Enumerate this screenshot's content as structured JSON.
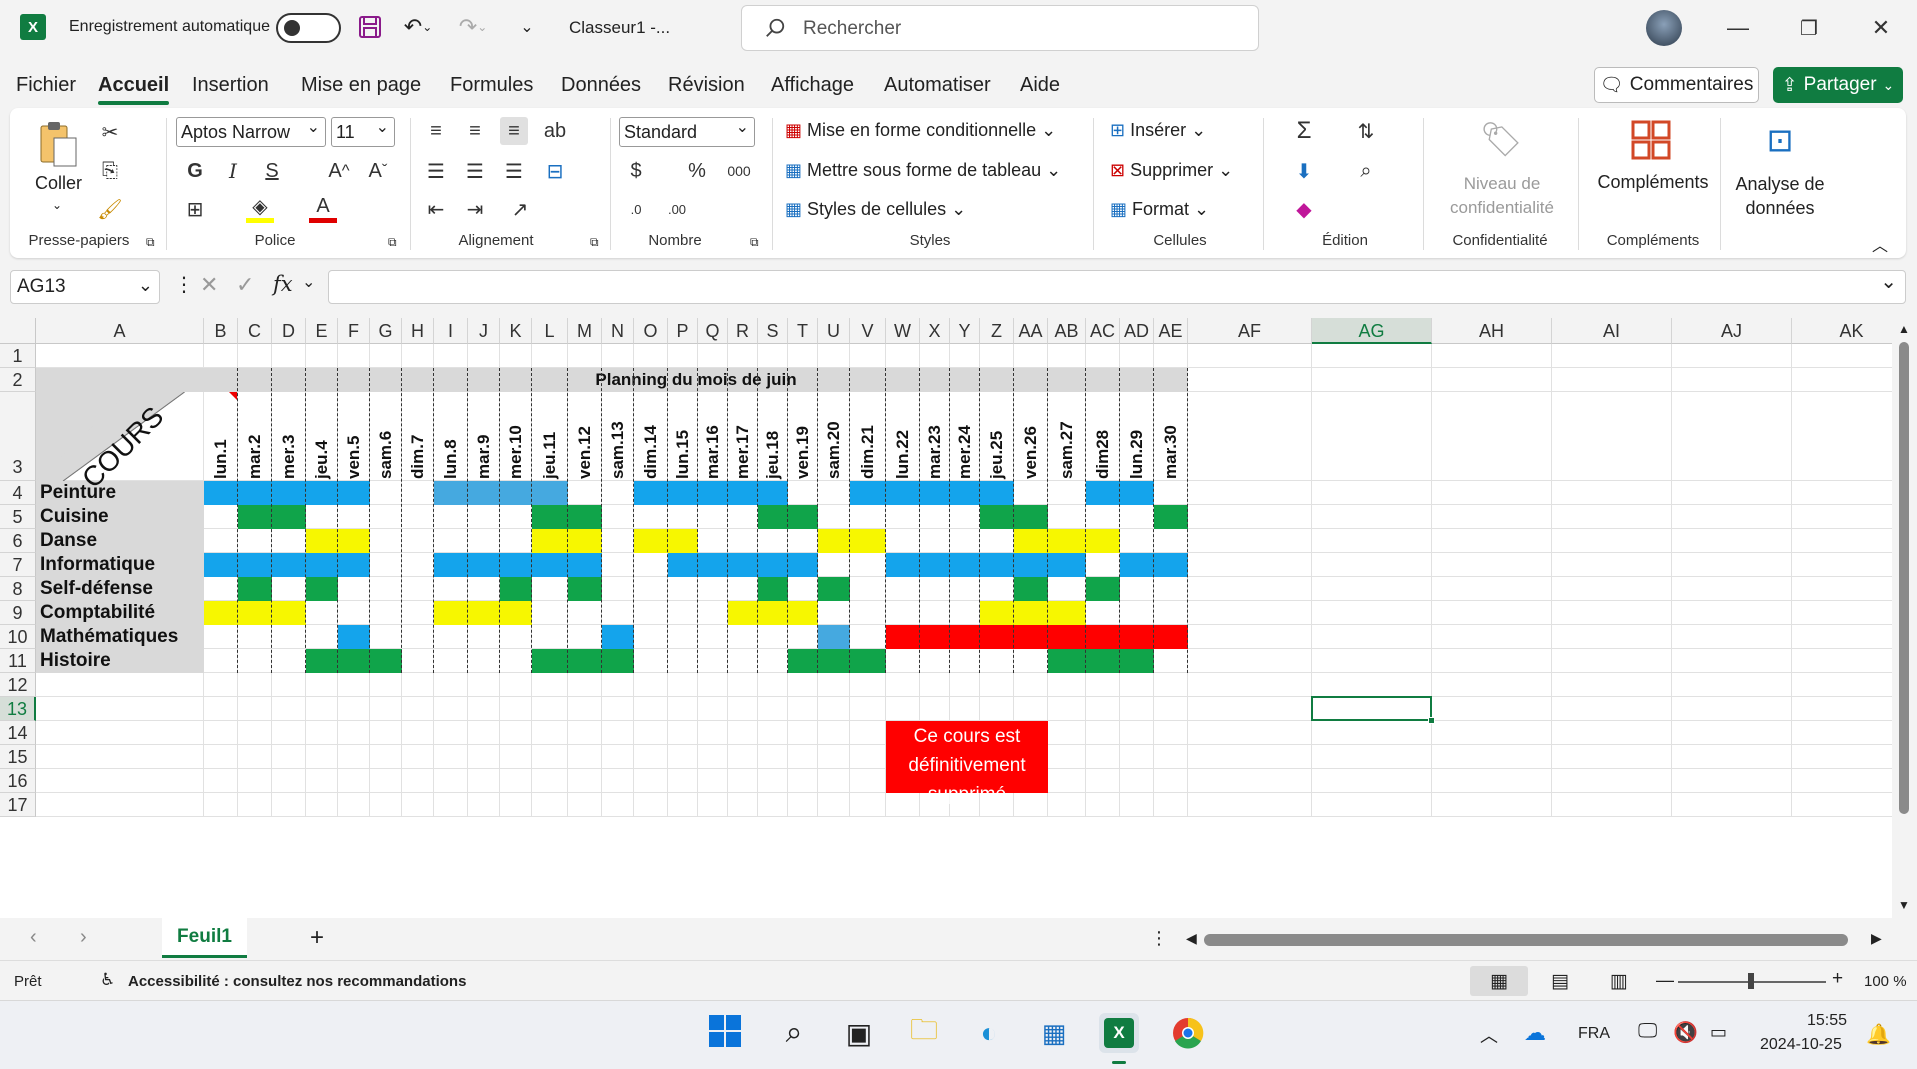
{
  "title": {
    "autosave": "Enregistrement automatique",
    "filename": "Classeur1  -...",
    "search_placeholder": "Rechercher"
  },
  "menu": {
    "tabs": [
      "Fichier",
      "Accueil",
      "Insertion",
      "Mise en page",
      "Formules",
      "Données",
      "Révision",
      "Affichage",
      "Automatiser",
      "Aide"
    ],
    "active": "Accueil",
    "comments": "Commentaires",
    "share": "Partager"
  },
  "ribbon": {
    "paste": "Coller",
    "font_name": "Aptos Narrow",
    "font_size": "11",
    "number_format": "Standard",
    "cond_format": "Mise en forme conditionnelle",
    "table_format": "Mettre sous forme de tableau",
    "cell_styles": "Styles de cellules",
    "insert": "Insérer",
    "delete": "Supprimer",
    "format": "Format",
    "sensitivity": "Niveau de confidentialité",
    "addins": "Compléments",
    "analyze": "Analyse de données",
    "groups": {
      "clipboard": "Presse-papiers",
      "font": "Police",
      "alignment": "Alignement",
      "number": "Nombre",
      "styles": "Styles",
      "cells": "Cellules",
      "editing": "Édition",
      "sensitivity": "Confidentialité",
      "addins": "Compléments"
    }
  },
  "formula_bar": {
    "name_box": "AG13",
    "fx": "fx",
    "value": ""
  },
  "sheet": {
    "columns": [
      "A",
      "B",
      "C",
      "D",
      "E",
      "F",
      "G",
      "H",
      "I",
      "J",
      "K",
      "L",
      "M",
      "N",
      "O",
      "P",
      "Q",
      "R",
      "S",
      "T",
      "U",
      "V",
      "W",
      "X",
      "Y",
      "Z",
      "AA",
      "AB",
      "AC",
      "AD",
      "AE",
      "AF",
      "AG",
      "AH",
      "AI",
      "AJ",
      "AK"
    ],
    "selected_column": "AG",
    "selected_row": "13",
    "rows": [
      "1",
      "2",
      "3",
      "4",
      "5",
      "6",
      "7",
      "8",
      "9",
      "10",
      "11",
      "12",
      "13",
      "14",
      "15",
      "16",
      "17"
    ],
    "header_title": "Planning du mois de juin",
    "corner_label": "COURS",
    "days": [
      "lun.1",
      "mar.2",
      "mer.3",
      "jeu.4",
      "ven.5",
      "sam.6",
      "dim.7",
      "lun.8",
      "mar.9",
      "mer.10",
      "jeu.11",
      "ven.12",
      "sam.13",
      "dim.14",
      "lun.15",
      "mar.16",
      "mer.17",
      "jeu.18",
      "ven.19",
      "sam.20",
      "dim.21",
      "lun.22",
      "mar.23",
      "mer.24",
      "jeu.25",
      "ven.26",
      "sam.27",
      "dim28",
      "lun.29",
      "mar.30"
    ],
    "courses": [
      "Peinture",
      "Cuisine",
      "Danse",
      "Informatique",
      "Self-défense",
      "Comptabilité",
      "Mathématiques",
      "Histoire"
    ],
    "colors": {
      "b": "#14a4ec",
      "l": "#45a9e0",
      "g": "#10a44a",
      "y": "#f7f700",
      "r": "#ff0000",
      "w": "#ffffff"
    },
    "schedule": [
      "bbbbb..llll..bbbbb..bbbbb..bb",
      ".gg.......gg.....gg.....gg...g",
      "...yy.....yy.yy....yy....yyy..",
      "bbbbb..bbbbb..bbbbb..bbbbbb.bb",
      ".g.g.....g.g.....g.g.....g.g..g",
      "yyy....yyy......yyy.....yyy...yy",
      "....b.......b......l.rrrrrrrrr",
      "...ggg....ggg.....ggg.....ggg.."
    ],
    "note": "Ce cours est définitivement supprimé",
    "sheet_tab": "Feuil1"
  },
  "status": {
    "ready": "Prêt",
    "accessibility": "Accessibilité : consultez nos recommandations",
    "zoom": "100 %"
  },
  "taskbar": {
    "lang": "FRA",
    "time": "15:55",
    "date": "2024-10-25"
  }
}
